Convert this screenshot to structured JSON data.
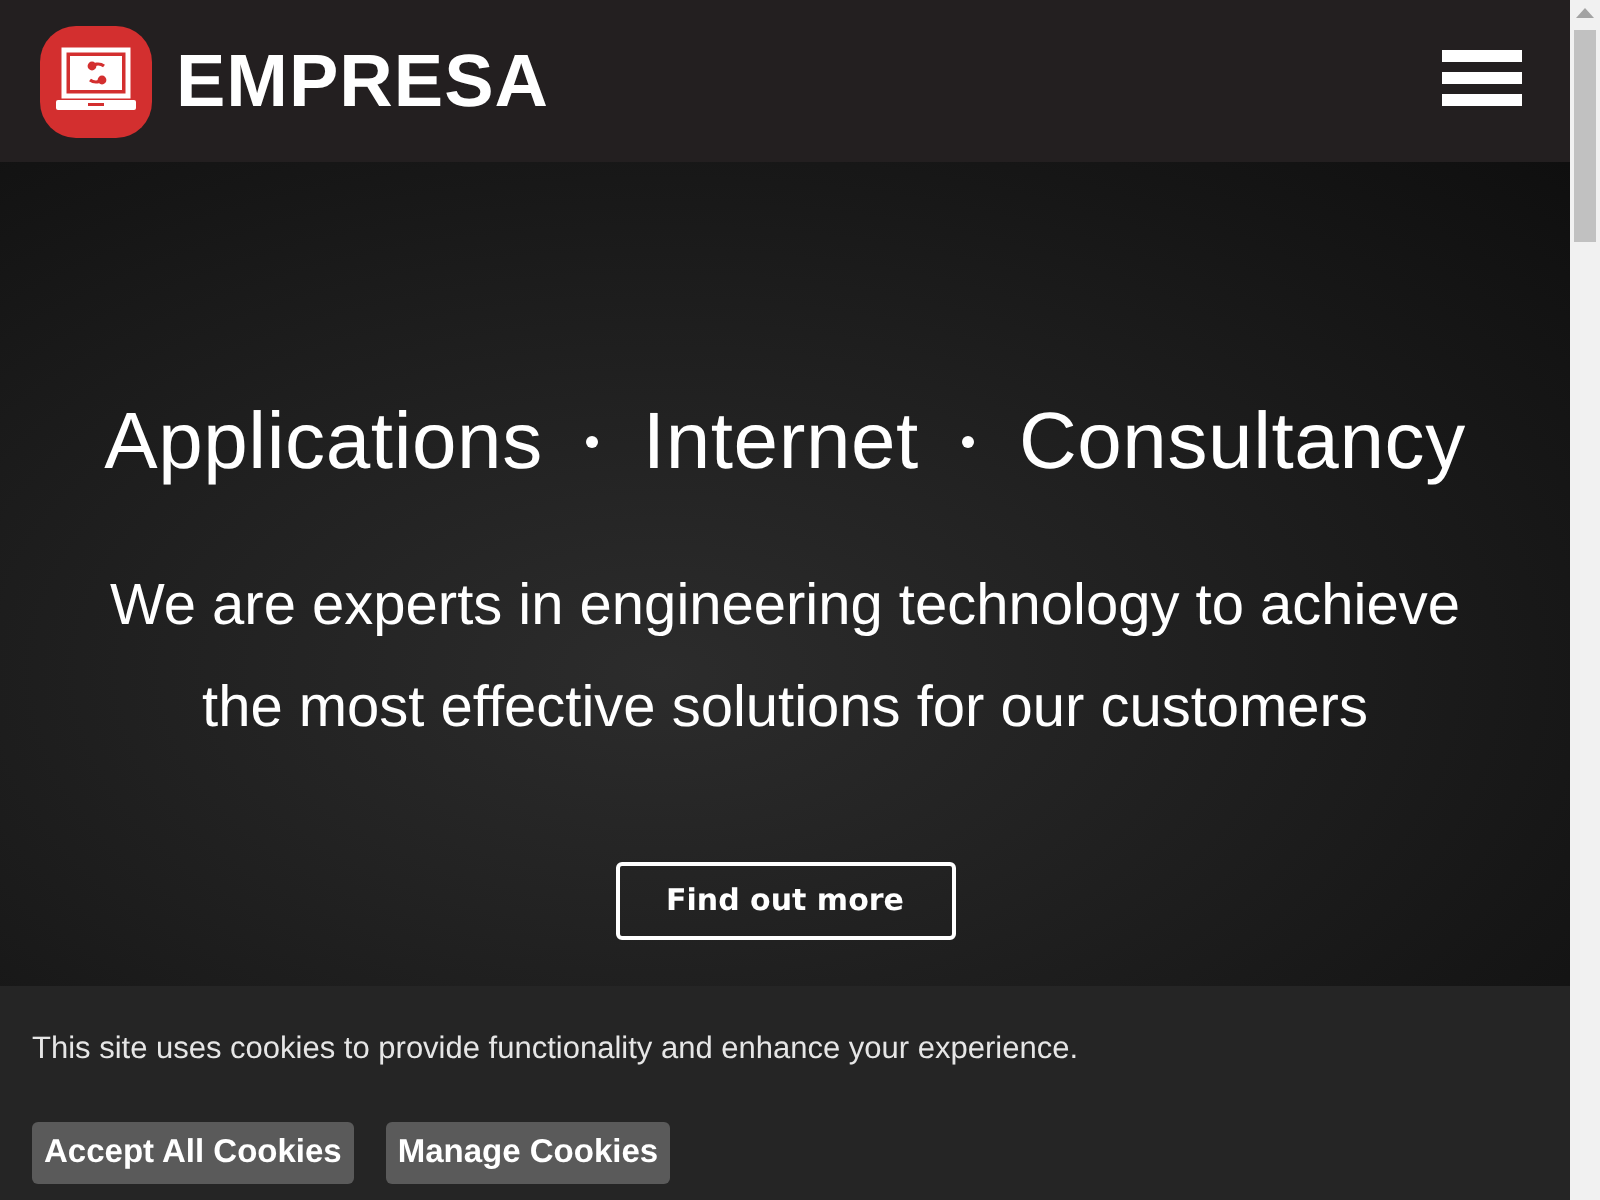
{
  "header": {
    "brand": "EMPRESA"
  },
  "hero": {
    "services": [
      "Applications",
      "Internet",
      "Consultancy"
    ],
    "tagline": "We are experts in engineering technology to achieve the most effective solutions for our customers",
    "button": "Find out more"
  },
  "cookie_banner": {
    "message": "This site uses cookies to provide functionality and enhance your experience.",
    "buttons": [
      "Accept All Cookies",
      "Manage Cookies"
    ]
  }
}
